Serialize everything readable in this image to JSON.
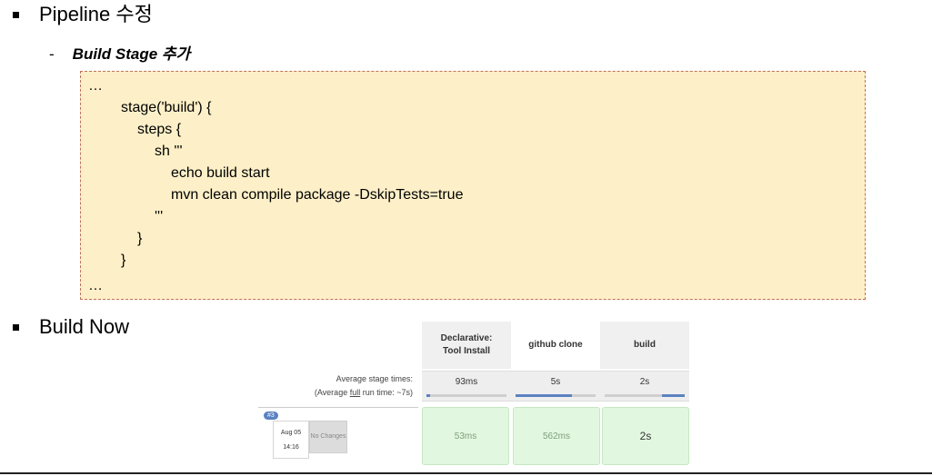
{
  "bullets": {
    "pipeline": "Pipeline 수정",
    "build_now": "Build Now"
  },
  "sub_bullet": {
    "dash": "-",
    "text": "Build Stage 추가"
  },
  "code_lines": [
    "…",
    "stage('build') {",
    "steps {",
    "sh '''",
    "echo build start",
    "mvn clean compile package -DskipTests=true",
    "'''",
    "}",
    "}",
    "…"
  ],
  "stage_view": {
    "stages": [
      {
        "name_line1": "Declarative:",
        "name_line2": "Tool Install",
        "avg": "93ms",
        "avg_fraction": 0.05,
        "run_time": "53ms"
      },
      {
        "name_line1": "github clone",
        "name_line2": "",
        "avg": "5s",
        "avg_fraction": 0.7,
        "run_time": "562ms"
      },
      {
        "name_line1": "build",
        "name_line2": "",
        "avg": "2s",
        "avg_fraction": 0.28,
        "run_time": "2s"
      }
    ],
    "avg_label": "Average stage times:",
    "avg_full_prefix": "(Average ",
    "avg_full_word": "full",
    "avg_full_suffix": " run time: ~7s)",
    "run": {
      "badge": "#3",
      "date": "Aug 05",
      "time": "14:16",
      "changes": "No Changes"
    },
    "colors": {
      "success_bg": "#e2f7e0",
      "progress": "#5b82c0"
    }
  }
}
